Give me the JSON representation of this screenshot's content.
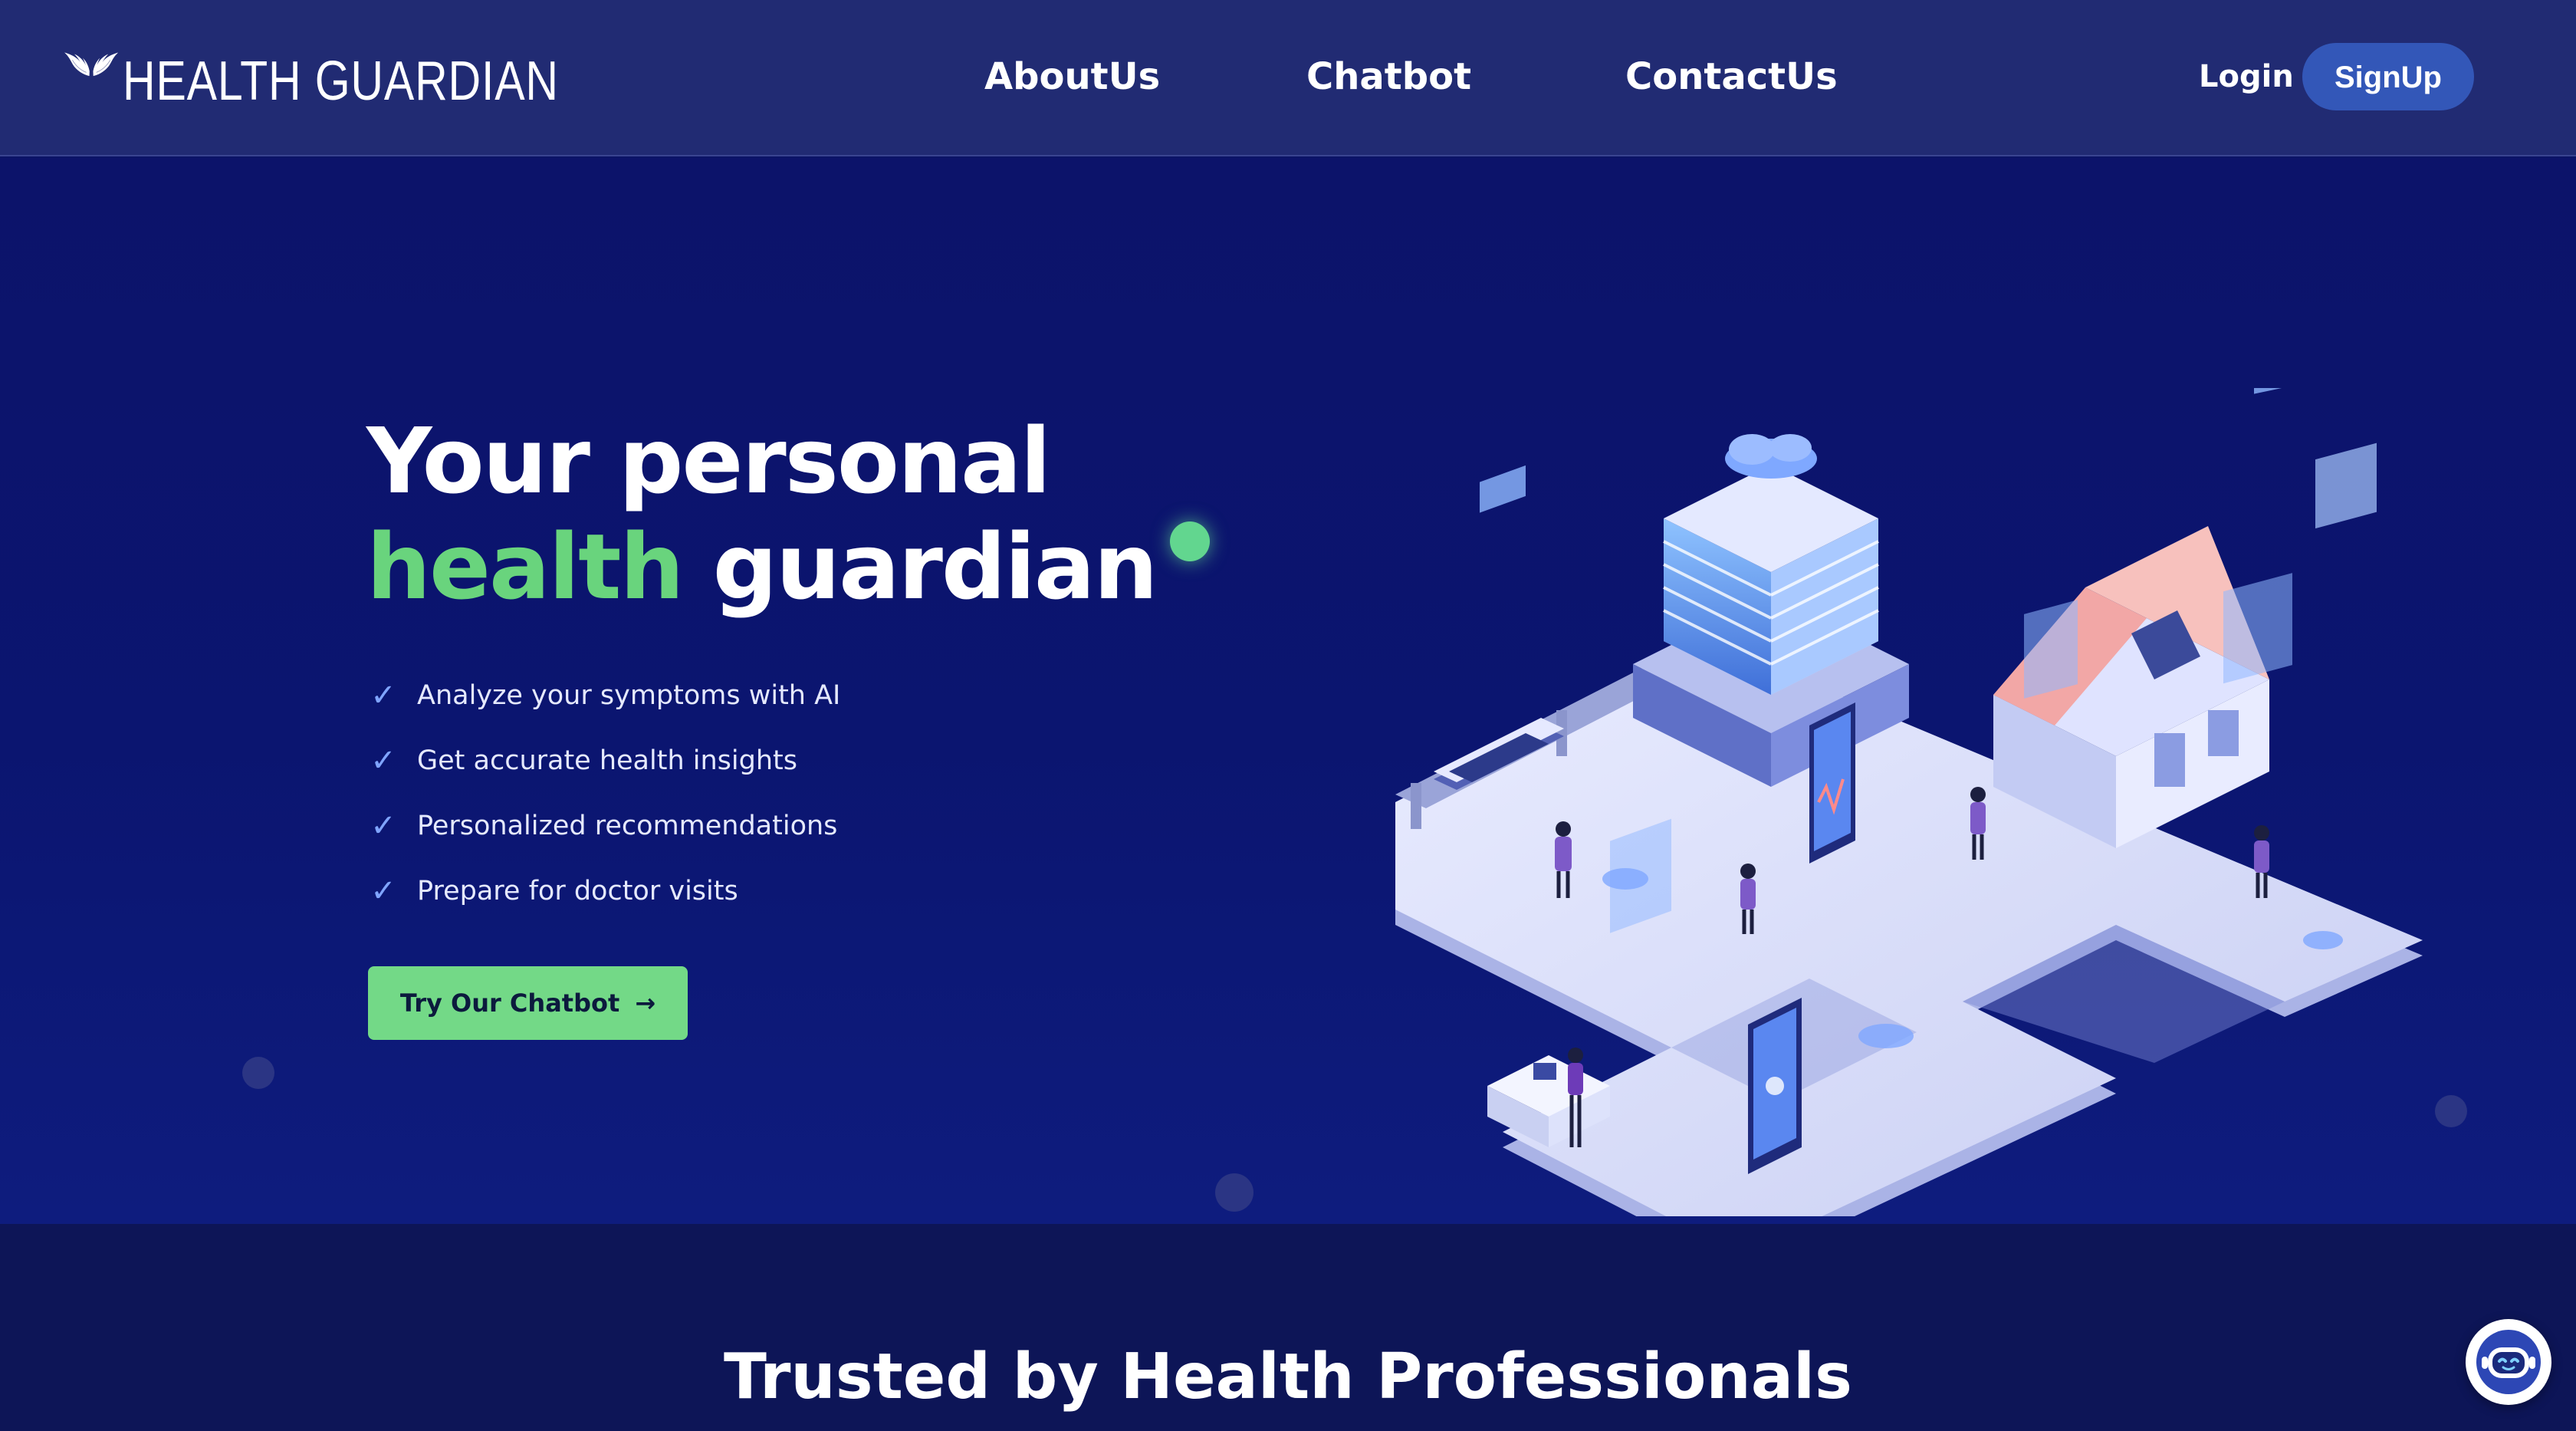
{
  "brand": {
    "name": "HEALTH GUARDIAN",
    "icon": "angel-wings-logo"
  },
  "nav": {
    "links": [
      "AboutUs",
      "Chatbot",
      "ContactUs"
    ],
    "login_label": "Login",
    "signup_label": "SignUp"
  },
  "hero": {
    "title_line1": "Your personal",
    "title_highlight": "health",
    "title_rest": "guardian",
    "features": [
      "Analyze your symptoms with AI",
      "Get accurate health insights",
      "Personalized recommendations",
      "Prepare for doctor visits"
    ],
    "cta_label": "Try Our Chatbot",
    "cta_icon": "arrow-right-icon"
  },
  "trusted": {
    "title": "Trusted by Health Professionals"
  },
  "chat_widget": {
    "icon": "robot-chat-icon"
  },
  "colors": {
    "accent_green": "#69d47d",
    "signup_blue": "#3357b8",
    "navbar_bg": "#212b73",
    "hero_bg": "#0c136a"
  }
}
